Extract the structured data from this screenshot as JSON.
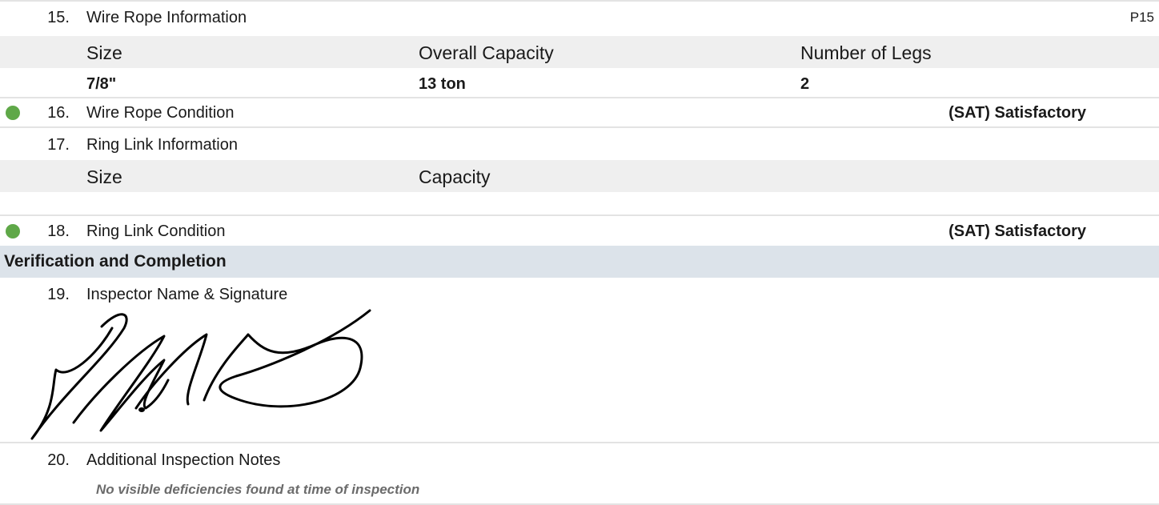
{
  "page_ref": "P15",
  "item15": {
    "number": "15.",
    "title": "Wire Rope Information",
    "headers": [
      "Size",
      "Overall Capacity",
      "Number of Legs"
    ],
    "values": [
      "7/8\"",
      "13 ton",
      "2"
    ]
  },
  "item16": {
    "number": "16.",
    "title": "Wire Rope Condition",
    "result": "(SAT) Satisfactory",
    "status_color": "#5fa848"
  },
  "item17": {
    "number": "17.",
    "title": "Ring Link Information",
    "headers": [
      "Size",
      "Capacity"
    ]
  },
  "item18": {
    "number": "18.",
    "title": "Ring Link Condition",
    "result": "(SAT) Satisfactory",
    "status_color": "#5fa848"
  },
  "section": {
    "title": "Verification and Completion"
  },
  "item19": {
    "number": "19.",
    "title": "Inspector Name & Signature"
  },
  "item20": {
    "number": "20.",
    "title": "Additional Inspection Notes",
    "note": "No visible deficiencies found at time of inspection"
  }
}
